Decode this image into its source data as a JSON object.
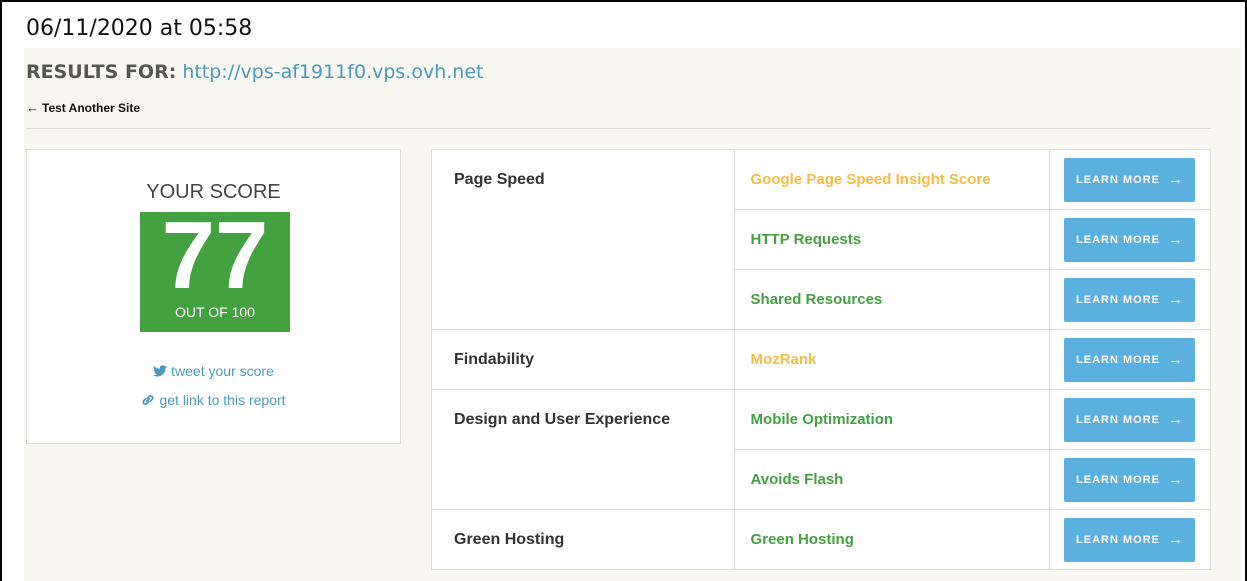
{
  "timestamp": "06/11/2020 at 05:58",
  "results": {
    "label": "RESULTS FOR:",
    "url": "http://vps-af1911f0.vps.ovh.net"
  },
  "back_link": {
    "icon": "arrow-left-icon",
    "label": "Test Another Site"
  },
  "score": {
    "title": "YOUR SCORE",
    "value": "77",
    "out_of": "OUT OF 100",
    "color": "#43a140",
    "tweet": {
      "icon": "twitter-icon",
      "label": "tweet your score"
    },
    "link": {
      "icon": "link-icon",
      "label": "get link to this report"
    }
  },
  "colors": {
    "accent_blue": "#5ab0de",
    "link_blue": "#4a9bbd",
    "warn_orange": "#f6bc42",
    "pass_green": "#43a140"
  },
  "button_label": "LEARN MORE",
  "categories": [
    {
      "name": "Page Speed",
      "metrics": [
        {
          "name": "Google Page Speed Insight Score",
          "status": "warn"
        },
        {
          "name": "HTTP Requests",
          "status": "pass"
        },
        {
          "name": "Shared Resources",
          "status": "pass"
        }
      ]
    },
    {
      "name": "Findability",
      "metrics": [
        {
          "name": "MozRank",
          "status": "warn"
        }
      ]
    },
    {
      "name": "Design and User Experience",
      "metrics": [
        {
          "name": "Mobile Optimization",
          "status": "pass"
        },
        {
          "name": "Avoids Flash",
          "status": "pass"
        }
      ]
    },
    {
      "name": "Green Hosting",
      "metrics": [
        {
          "name": "Green Hosting",
          "status": "pass"
        }
      ]
    }
  ]
}
